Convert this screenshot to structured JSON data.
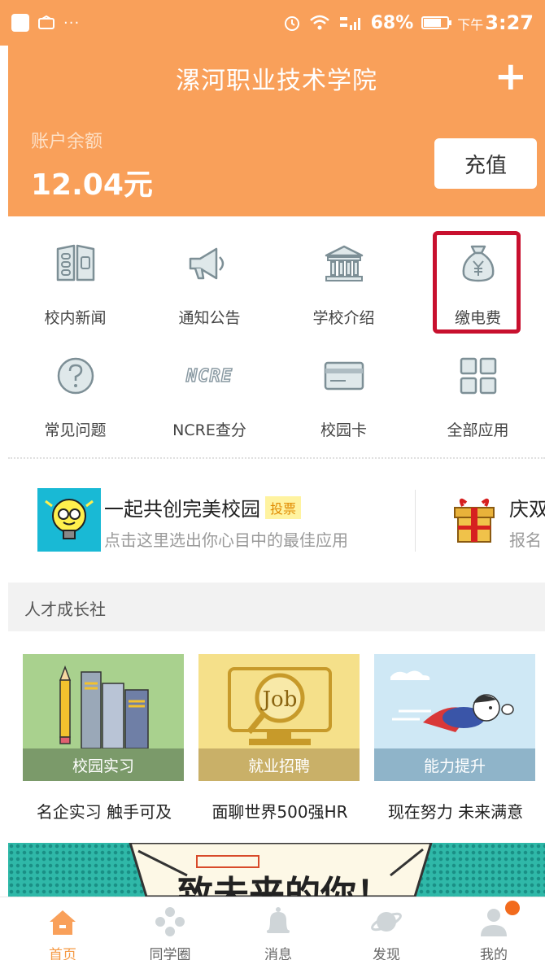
{
  "status_bar": {
    "battery": "68%",
    "time_prefix": "下午",
    "time": "3:27"
  },
  "header": {
    "title": "漯河职业技术学院",
    "balance_label": "账户余额",
    "balance_value": "12.04元",
    "recharge_label": "充值"
  },
  "grid": [
    {
      "label": "校内新闻",
      "icon": "news-book-icon"
    },
    {
      "label": "通知公告",
      "icon": "megaphone-icon"
    },
    {
      "label": "学校介绍",
      "icon": "school-building-icon"
    },
    {
      "label": "缴电费",
      "icon": "money-bag-yen-icon"
    },
    {
      "label": "常见问题",
      "icon": "question-circle-icon"
    },
    {
      "label": "NCRE查分",
      "icon": "ncre-text-icon",
      "icon_text": "NCRE"
    },
    {
      "label": "校园卡",
      "icon": "card-icon"
    },
    {
      "label": "全部应用",
      "icon": "apps-grid-icon"
    }
  ],
  "promo": {
    "title": "一起共创完美校园",
    "badge": "投票",
    "subtitle": "点击这里选出你心目中的最佳应用",
    "title2": "庆双",
    "subtitle2": "报名"
  },
  "section": {
    "title": "人才成长社"
  },
  "cards": [
    {
      "caption": "校园实习",
      "desc": "名企实习 触手可及",
      "bg": "#a9d18e",
      "cap_bg": "#7b9a6a"
    },
    {
      "caption": "就业招聘",
      "desc": "面聊世界500强HR",
      "bg": "#f5e08a",
      "cap_bg": "#c9b068",
      "icon_text": "Job"
    },
    {
      "caption": "能力提升",
      "desc": "现在努力 未来满意",
      "bg": "#cfe8f5",
      "cap_bg": "#8fb4c9"
    }
  ],
  "banner": {
    "caption": "致未来的你！"
  },
  "bottom_nav": [
    {
      "label": "首页",
      "icon": "home-icon",
      "active": true
    },
    {
      "label": "同学圈",
      "icon": "circle-dots-icon",
      "active": false
    },
    {
      "label": "消息",
      "icon": "bell-icon",
      "active": false
    },
    {
      "label": "发现",
      "icon": "planet-icon",
      "active": false
    },
    {
      "label": "我的",
      "icon": "user-icon",
      "active": false
    }
  ],
  "colors": {
    "accent": "#f9a05a",
    "highlight_box": "#c8102e",
    "nav_active": "#f59a45"
  }
}
